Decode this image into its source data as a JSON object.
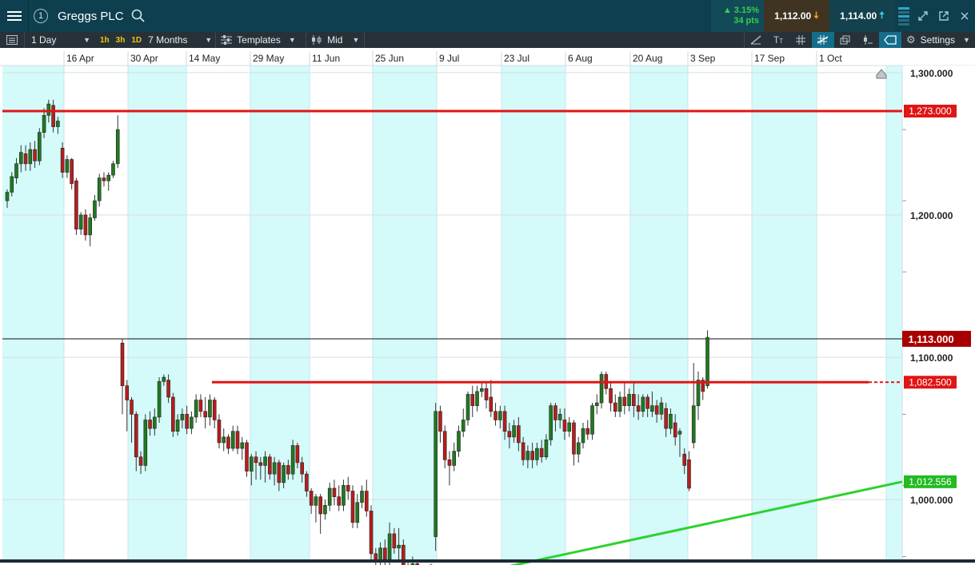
{
  "instrument": {
    "number": "1",
    "name": "Greggs PLC"
  },
  "quote": {
    "change_pct": "▲ 3.15%",
    "change_pts": "34 pts",
    "sell": "1,112.00",
    "buy": "1,114.00"
  },
  "toolbar": {
    "interval": "1 Day",
    "periods": [
      "1h",
      "3h",
      "1D"
    ],
    "range": "7 Months",
    "templates": "Templates",
    "price_type": "Mid",
    "settings": "Settings"
  },
  "colors": {
    "title_bg": "#0e3f4f",
    "band": "#d4fafa",
    "up": "#1f7a1f",
    "down": "#b81d1d",
    "resistance": "#e01515",
    "support": "#2ed12e",
    "current": "#a80000"
  },
  "chart_data": {
    "type": "candlestick",
    "x_labels": [
      "16 Apr",
      "30 Apr",
      "14 May",
      "29 May",
      "11 Jun",
      "25 Jun",
      "9 Jul",
      "23 Jul",
      "6 Aug",
      "20 Aug",
      "3 Sep",
      "17 Sep",
      "1 Oct"
    ],
    "y_tick_labels": [
      "1,300.000",
      "1,200.000",
      "1,100.000",
      "1,000.000"
    ],
    "y_ticks": [
      1300,
      1200,
      1100,
      1000
    ],
    "ylim": [
      958,
      1305
    ],
    "resistance_1": {
      "label": "1,273.000",
      "value": 1273
    },
    "resistance_2": {
      "label": "1,082.500",
      "value": 1082.5
    },
    "support": {
      "label": "1,012.556",
      "value": 1012.556,
      "start_value": 953
    },
    "current_price": {
      "label": "1,113.000",
      "value": 1113
    },
    "candles": [
      [
        1210,
        1216,
        1205,
        1218
      ],
      [
        1216,
        1227,
        1213,
        1230
      ],
      [
        1226,
        1236,
        1222,
        1240
      ],
      [
        1236,
        1244,
        1230,
        1249
      ],
      [
        1243,
        1236,
        1231,
        1249
      ],
      [
        1236,
        1246,
        1231,
        1251
      ],
      [
        1246,
        1238,
        1233,
        1252
      ],
      [
        1238,
        1258,
        1235,
        1261
      ],
      [
        1258,
        1270,
        1254,
        1275
      ],
      [
        1270,
        1278,
        1265,
        1281
      ],
      [
        1277,
        1262,
        1258,
        1281
      ],
      [
        1262,
        1266,
        1257,
        1269
      ],
      [
        1247,
        1230,
        1226,
        1251
      ],
      [
        1230,
        1239,
        1226,
        1242
      ],
      [
        1239,
        1222,
        1218,
        1240
      ],
      [
        1224,
        1190,
        1186,
        1226
      ],
      [
        1190,
        1200,
        1186,
        1202
      ],
      [
        1200,
        1186,
        1182,
        1204
      ],
      [
        1186,
        1198,
        1178,
        1201
      ],
      [
        1198,
        1210,
        1196,
        1214
      ],
      [
        1210,
        1226,
        1206,
        1229
      ],
      [
        1226,
        1224,
        1220,
        1230
      ],
      [
        1224,
        1228,
        1217,
        1230
      ],
      [
        1228,
        1236,
        1226,
        1238
      ],
      [
        1236,
        1260,
        1233,
        1270
      ],
      [
        1110,
        1080,
        1060,
        1113
      ],
      [
        1080,
        1070,
        1048,
        1084
      ],
      [
        1070,
        1060,
        1040,
        1072
      ],
      [
        1060,
        1030,
        1020,
        1062
      ],
      [
        1030,
        1024,
        1018,
        1034
      ],
      [
        1024,
        1056,
        1020,
        1060
      ],
      [
        1056,
        1050,
        1045,
        1062
      ],
      [
        1050,
        1058,
        1045,
        1064
      ],
      [
        1058,
        1083,
        1054,
        1086
      ],
      [
        1083,
        1086,
        1080,
        1088
      ],
      [
        1084,
        1072,
        1068,
        1088
      ],
      [
        1072,
        1048,
        1044,
        1075
      ],
      [
        1048,
        1056,
        1045,
        1060
      ],
      [
        1056,
        1060,
        1050,
        1064
      ],
      [
        1060,
        1050,
        1046,
        1066
      ],
      [
        1050,
        1058,
        1046,
        1062
      ],
      [
        1058,
        1070,
        1054,
        1074
      ],
      [
        1070,
        1062,
        1058,
        1074
      ],
      [
        1062,
        1058,
        1050,
        1072
      ],
      [
        1058,
        1070,
        1052,
        1074
      ],
      [
        1070,
        1056,
        1050,
        1072
      ],
      [
        1056,
        1040,
        1036,
        1060
      ],
      [
        1040,
        1044,
        1034,
        1050
      ],
      [
        1044,
        1036,
        1032,
        1046
      ],
      [
        1036,
        1048,
        1034,
        1052
      ],
      [
        1048,
        1036,
        1032,
        1052
      ],
      [
        1036,
        1040,
        1028,
        1044
      ],
      [
        1040,
        1020,
        1016,
        1042
      ],
      [
        1020,
        1030,
        1010,
        1032
      ],
      [
        1030,
        1026,
        1014,
        1034
      ],
      [
        1026,
        1024,
        1014,
        1030
      ],
      [
        1024,
        1030,
        1012,
        1034
      ],
      [
        1030,
        1018,
        1014,
        1032
      ],
      [
        1018,
        1026,
        1010,
        1030
      ],
      [
        1026,
        1012,
        1006,
        1028
      ],
      [
        1012,
        1024,
        1008,
        1026
      ],
      [
        1024,
        1018,
        1014,
        1028
      ],
      [
        1018,
        1038,
        1014,
        1042
      ],
      [
        1038,
        1026,
        1022,
        1040
      ],
      [
        1026,
        1018,
        1012,
        1030
      ],
      [
        1018,
        1006,
        1002,
        1020
      ],
      [
        1006,
        996,
        990,
        1008
      ],
      [
        996,
        1002,
        984,
        1004
      ],
      [
        1002,
        990,
        976,
        1004
      ],
      [
        990,
        996,
        986,
        1000
      ],
      [
        996,
        1008,
        992,
        1012
      ],
      [
        1008,
        1002,
        996,
        1014
      ],
      [
        1002,
        996,
        992,
        1010
      ],
      [
        996,
        1010,
        992,
        1014
      ],
      [
        1010,
        1006,
        1000,
        1016
      ],
      [
        1006,
        984,
        980,
        1010
      ],
      [
        984,
        998,
        980,
        1004
      ],
      [
        998,
        1006,
        994,
        1010
      ],
      [
        1006,
        992,
        988,
        1014
      ],
      [
        992,
        962,
        958,
        996
      ],
      [
        962,
        956,
        950,
        966
      ],
      [
        956,
        966,
        950,
        970
      ],
      [
        966,
        958,
        952,
        972
      ],
      [
        958,
        976,
        954,
        984
      ],
      [
        976,
        966,
        962,
        980
      ],
      [
        966,
        968,
        956,
        980
      ],
      [
        968,
        950,
        944,
        972
      ],
      [
        950,
        938,
        934,
        956
      ],
      [
        940,
        955,
        934,
        960
      ],
      [
        955,
        940,
        934,
        958
      ],
      [
        940,
        944,
        936,
        950
      ],
      [
        944,
        948,
        938,
        952
      ],
      [
        948,
        954,
        944,
        955
      ],
      [
        974,
        1062,
        964,
        1068
      ],
      [
        1062,
        1048,
        1040,
        1066
      ],
      [
        1048,
        1028,
        1022,
        1052
      ],
      [
        1028,
        1024,
        1010,
        1034
      ],
      [
        1024,
        1034,
        1020,
        1040
      ],
      [
        1034,
        1048,
        1030,
        1052
      ],
      [
        1048,
        1056,
        1044,
        1064
      ],
      [
        1056,
        1074,
        1052,
        1076
      ],
      [
        1074,
        1066,
        1058,
        1080
      ],
      [
        1066,
        1076,
        1062,
        1080
      ],
      [
        1076,
        1078,
        1072,
        1082
      ],
      [
        1078,
        1070,
        1064,
        1082
      ],
      [
        1072,
        1062,
        1058,
        1084
      ],
      [
        1062,
        1056,
        1052,
        1068
      ],
      [
        1056,
        1062,
        1050,
        1066
      ],
      [
        1062,
        1048,
        1042,
        1066
      ],
      [
        1048,
        1044,
        1036,
        1054
      ],
      [
        1044,
        1052,
        1040,
        1056
      ],
      [
        1052,
        1040,
        1034,
        1058
      ],
      [
        1040,
        1028,
        1024,
        1044
      ],
      [
        1028,
        1034,
        1022,
        1038
      ],
      [
        1034,
        1028,
        1022,
        1040
      ],
      [
        1028,
        1036,
        1024,
        1040
      ],
      [
        1036,
        1030,
        1026,
        1042
      ],
      [
        1030,
        1042,
        1028,
        1046
      ],
      [
        1042,
        1066,
        1038,
        1068
      ],
      [
        1066,
        1056,
        1048,
        1068
      ],
      [
        1056,
        1060,
        1050,
        1064
      ],
      [
        1056,
        1048,
        1042,
        1064
      ],
      [
        1048,
        1054,
        1044,
        1058
      ],
      [
        1054,
        1032,
        1024,
        1056
      ],
      [
        1032,
        1040,
        1026,
        1044
      ],
      [
        1040,
        1050,
        1036,
        1054
      ],
      [
        1050,
        1046,
        1042,
        1056
      ],
      [
        1046,
        1066,
        1042,
        1068
      ],
      [
        1066,
        1068,
        1060,
        1074
      ],
      [
        1068,
        1088,
        1064,
        1090
      ],
      [
        1088,
        1078,
        1074,
        1090
      ],
      [
        1078,
        1068,
        1062,
        1082
      ],
      [
        1068,
        1062,
        1058,
        1074
      ],
      [
        1062,
        1072,
        1058,
        1076
      ],
      [
        1072,
        1066,
        1060,
        1082
      ],
      [
        1066,
        1074,
        1062,
        1078
      ],
      [
        1074,
        1066,
        1058,
        1082
      ],
      [
        1066,
        1062,
        1056,
        1074
      ],
      [
        1062,
        1072,
        1058,
        1074
      ],
      [
        1072,
        1064,
        1058,
        1074
      ],
      [
        1062,
        1066,
        1058,
        1076
      ],
      [
        1066,
        1060,
        1054,
        1070
      ],
      [
        1060,
        1068,
        1056,
        1072
      ],
      [
        1064,
        1050,
        1044,
        1068
      ],
      [
        1050,
        1060,
        1046,
        1064
      ],
      [
        1054,
        1044,
        1038,
        1060
      ],
      [
        1046,
        1048,
        1030,
        1050
      ],
      [
        1032,
        1024,
        1018,
        1036
      ],
      [
        1028,
        1008,
        1006,
        1034
      ],
      [
        1040,
        1066,
        1036,
        1096
      ],
      [
        1066,
        1084,
        1056,
        1090
      ],
      [
        1084,
        1076,
        1070,
        1086
      ],
      [
        1080,
        1114,
        1078,
        1119
      ]
    ]
  }
}
